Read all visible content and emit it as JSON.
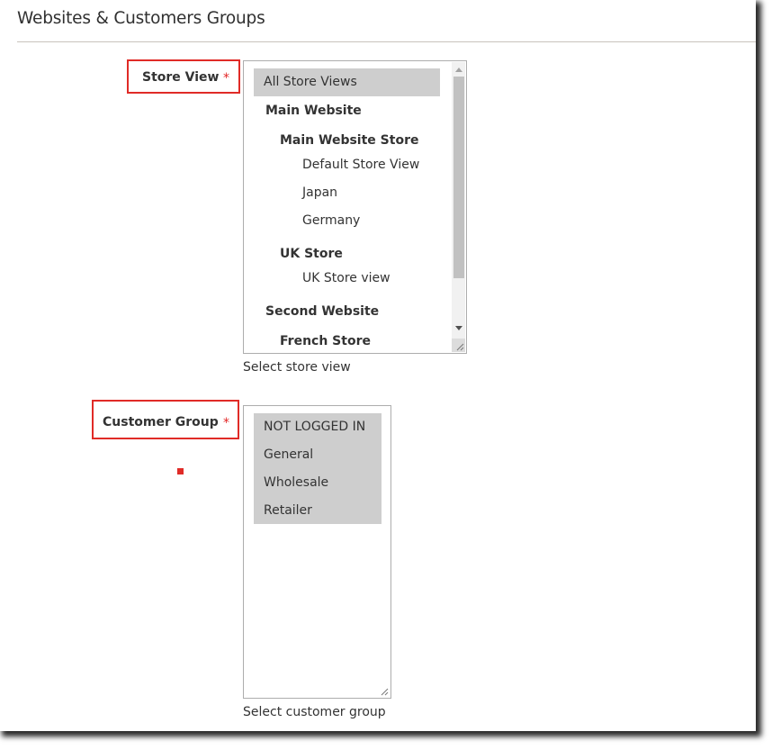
{
  "section": {
    "title": "Websites & Customers Groups"
  },
  "store_view": {
    "label": "Store View",
    "required_marker": "*",
    "helper_text": "Select store view",
    "options": [
      {
        "label": "All Store Views",
        "level": 0,
        "type": "option",
        "selected": true
      },
      {
        "label": "Main Website",
        "level": 1,
        "type": "group"
      },
      {
        "label": "Main Website Store",
        "level": 2,
        "type": "group"
      },
      {
        "label": "Default Store View",
        "level": 3,
        "type": "option",
        "selected": false
      },
      {
        "label": "Japan",
        "level": 3,
        "type": "option",
        "selected": false
      },
      {
        "label": "Germany",
        "level": 3,
        "type": "option",
        "selected": false
      },
      {
        "label": "UK Store",
        "level": 2,
        "type": "group"
      },
      {
        "label": "UK Store view",
        "level": 3,
        "type": "option",
        "selected": false
      },
      {
        "label": "Second Website",
        "level": 1,
        "type": "group"
      },
      {
        "label": "French Store",
        "level": 2,
        "type": "group"
      }
    ]
  },
  "customer_group": {
    "label": "Customer Group",
    "required_marker": "*",
    "helper_text": "Select customer group",
    "options": [
      {
        "label": "NOT LOGGED IN",
        "selected": true
      },
      {
        "label": "General",
        "selected": true
      },
      {
        "label": "Wholesale",
        "selected": true
      },
      {
        "label": "Retailer",
        "selected": true
      }
    ]
  },
  "colors": {
    "highlight_border": "#e02b27",
    "required_star": "#e22626",
    "selected_option_bg": "#cecece",
    "divider": "#c8c3bc"
  }
}
